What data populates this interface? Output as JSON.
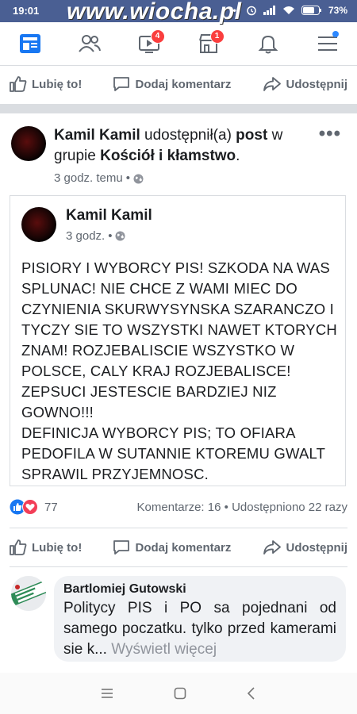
{
  "status": {
    "time": "19:01",
    "battery": "73%"
  },
  "watermark": "www.wiocha.pl",
  "nav": {
    "video_badge": "4",
    "marketplace_badge": "1"
  },
  "actions": {
    "like": "Lubię to!",
    "comment": "Dodaj komentarz",
    "share": "Udostępnij"
  },
  "post": {
    "author": "Kamil Kamil",
    "shared_text": "udostępnił(a)",
    "post_word": "post",
    "in_group": "w grupie",
    "group": "Kościół i kłamstwo",
    "period": ".",
    "time": "3 godz. temu",
    "dot": "•",
    "more": "•••"
  },
  "shared_post": {
    "author": "Kamil Kamil",
    "time": "3 godz.",
    "dot": "•",
    "body": "PISIORY I WYBORCY PIS! SZKODA NA WAS SPLUNAC! NIE CHCE Z  WAMI MIEC DO CZYNIENIA SKURWYSYNSKA SZARANCZO I TYCZY SIE TO WSZYSTKI NAWET KTORYCH ZNAM! ROZJEBALISCIE WSZYSTKO W POLSCE, CALY KRAJ ROZJEBALISCE! ZEPSUCI JESTESCIE BARDZIEJ NIZ GOWNO!!!\nDEFINICJA WYBORCY PIS; TO OFIARA PEDOFILA W SUTANNIE KTOREMU GWALT SPRAWIL PRZYJEMNOSC."
  },
  "reactions": {
    "count": "77",
    "comments": "Komentarze: 16",
    "dot": "•",
    "shares": "Udostępniono 22 razy"
  },
  "comment": {
    "author": "Bartlomiej Gutowski",
    "text": "Politycy PIS i PO sa pojednani od samego poczatku. tylko przed kamerami sie k...",
    "see_more": "Wyświetl więcej",
    "avatar_label": "Stowarzyszenie Przemian"
  },
  "colors": {
    "statusbar": "#4a5f93",
    "like_blue": "#1877f2",
    "love_red": "#f33e58",
    "text_gray": "#606770"
  }
}
